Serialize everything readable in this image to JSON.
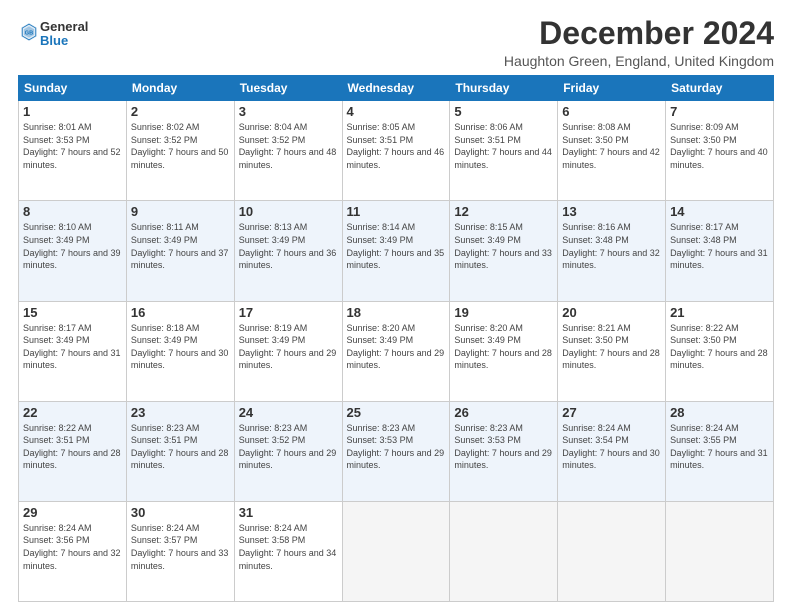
{
  "logo": {
    "line1": "General",
    "line2": "Blue",
    "icon_color": "#1a75bb"
  },
  "title": "December 2024",
  "location": "Haughton Green, England, United Kingdom",
  "weekdays": [
    "Sunday",
    "Monday",
    "Tuesday",
    "Wednesday",
    "Thursday",
    "Friday",
    "Saturday"
  ],
  "weeks": [
    [
      {
        "day": "1",
        "sunrise": "Sunrise: 8:01 AM",
        "sunset": "Sunset: 3:53 PM",
        "daylight": "Daylight: 7 hours and 52 minutes."
      },
      {
        "day": "2",
        "sunrise": "Sunrise: 8:02 AM",
        "sunset": "Sunset: 3:52 PM",
        "daylight": "Daylight: 7 hours and 50 minutes."
      },
      {
        "day": "3",
        "sunrise": "Sunrise: 8:04 AM",
        "sunset": "Sunset: 3:52 PM",
        "daylight": "Daylight: 7 hours and 48 minutes."
      },
      {
        "day": "4",
        "sunrise": "Sunrise: 8:05 AM",
        "sunset": "Sunset: 3:51 PM",
        "daylight": "Daylight: 7 hours and 46 minutes."
      },
      {
        "day": "5",
        "sunrise": "Sunrise: 8:06 AM",
        "sunset": "Sunset: 3:51 PM",
        "daylight": "Daylight: 7 hours and 44 minutes."
      },
      {
        "day": "6",
        "sunrise": "Sunrise: 8:08 AM",
        "sunset": "Sunset: 3:50 PM",
        "daylight": "Daylight: 7 hours and 42 minutes."
      },
      {
        "day": "7",
        "sunrise": "Sunrise: 8:09 AM",
        "sunset": "Sunset: 3:50 PM",
        "daylight": "Daylight: 7 hours and 40 minutes."
      }
    ],
    [
      {
        "day": "8",
        "sunrise": "Sunrise: 8:10 AM",
        "sunset": "Sunset: 3:49 PM",
        "daylight": "Daylight: 7 hours and 39 minutes."
      },
      {
        "day": "9",
        "sunrise": "Sunrise: 8:11 AM",
        "sunset": "Sunset: 3:49 PM",
        "daylight": "Daylight: 7 hours and 37 minutes."
      },
      {
        "day": "10",
        "sunrise": "Sunrise: 8:13 AM",
        "sunset": "Sunset: 3:49 PM",
        "daylight": "Daylight: 7 hours and 36 minutes."
      },
      {
        "day": "11",
        "sunrise": "Sunrise: 8:14 AM",
        "sunset": "Sunset: 3:49 PM",
        "daylight": "Daylight: 7 hours and 35 minutes."
      },
      {
        "day": "12",
        "sunrise": "Sunrise: 8:15 AM",
        "sunset": "Sunset: 3:49 PM",
        "daylight": "Daylight: 7 hours and 33 minutes."
      },
      {
        "day": "13",
        "sunrise": "Sunrise: 8:16 AM",
        "sunset": "Sunset: 3:48 PM",
        "daylight": "Daylight: 7 hours and 32 minutes."
      },
      {
        "day": "14",
        "sunrise": "Sunrise: 8:17 AM",
        "sunset": "Sunset: 3:48 PM",
        "daylight": "Daylight: 7 hours and 31 minutes."
      }
    ],
    [
      {
        "day": "15",
        "sunrise": "Sunrise: 8:17 AM",
        "sunset": "Sunset: 3:49 PM",
        "daylight": "Daylight: 7 hours and 31 minutes."
      },
      {
        "day": "16",
        "sunrise": "Sunrise: 8:18 AM",
        "sunset": "Sunset: 3:49 PM",
        "daylight": "Daylight: 7 hours and 30 minutes."
      },
      {
        "day": "17",
        "sunrise": "Sunrise: 8:19 AM",
        "sunset": "Sunset: 3:49 PM",
        "daylight": "Daylight: 7 hours and 29 minutes."
      },
      {
        "day": "18",
        "sunrise": "Sunrise: 8:20 AM",
        "sunset": "Sunset: 3:49 PM",
        "daylight": "Daylight: 7 hours and 29 minutes."
      },
      {
        "day": "19",
        "sunrise": "Sunrise: 8:20 AM",
        "sunset": "Sunset: 3:49 PM",
        "daylight": "Daylight: 7 hours and 28 minutes."
      },
      {
        "day": "20",
        "sunrise": "Sunrise: 8:21 AM",
        "sunset": "Sunset: 3:50 PM",
        "daylight": "Daylight: 7 hours and 28 minutes."
      },
      {
        "day": "21",
        "sunrise": "Sunrise: 8:22 AM",
        "sunset": "Sunset: 3:50 PM",
        "daylight": "Daylight: 7 hours and 28 minutes."
      }
    ],
    [
      {
        "day": "22",
        "sunrise": "Sunrise: 8:22 AM",
        "sunset": "Sunset: 3:51 PM",
        "daylight": "Daylight: 7 hours and 28 minutes."
      },
      {
        "day": "23",
        "sunrise": "Sunrise: 8:23 AM",
        "sunset": "Sunset: 3:51 PM",
        "daylight": "Daylight: 7 hours and 28 minutes."
      },
      {
        "day": "24",
        "sunrise": "Sunrise: 8:23 AM",
        "sunset": "Sunset: 3:52 PM",
        "daylight": "Daylight: 7 hours and 29 minutes."
      },
      {
        "day": "25",
        "sunrise": "Sunrise: 8:23 AM",
        "sunset": "Sunset: 3:53 PM",
        "daylight": "Daylight: 7 hours and 29 minutes."
      },
      {
        "day": "26",
        "sunrise": "Sunrise: 8:23 AM",
        "sunset": "Sunset: 3:53 PM",
        "daylight": "Daylight: 7 hours and 29 minutes."
      },
      {
        "day": "27",
        "sunrise": "Sunrise: 8:24 AM",
        "sunset": "Sunset: 3:54 PM",
        "daylight": "Daylight: 7 hours and 30 minutes."
      },
      {
        "day": "28",
        "sunrise": "Sunrise: 8:24 AM",
        "sunset": "Sunset: 3:55 PM",
        "daylight": "Daylight: 7 hours and 31 minutes."
      }
    ],
    [
      {
        "day": "29",
        "sunrise": "Sunrise: 8:24 AM",
        "sunset": "Sunset: 3:56 PM",
        "daylight": "Daylight: 7 hours and 32 minutes."
      },
      {
        "day": "30",
        "sunrise": "Sunrise: 8:24 AM",
        "sunset": "Sunset: 3:57 PM",
        "daylight": "Daylight: 7 hours and 33 minutes."
      },
      {
        "day": "31",
        "sunrise": "Sunrise: 8:24 AM",
        "sunset": "Sunset: 3:58 PM",
        "daylight": "Daylight: 7 hours and 34 minutes."
      },
      null,
      null,
      null,
      null
    ]
  ]
}
